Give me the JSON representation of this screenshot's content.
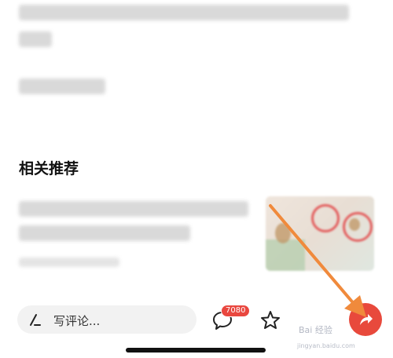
{
  "section": {
    "title": "相关推荐"
  },
  "bottom_bar": {
    "comment_placeholder": "写评论...",
    "comment_count": "7080"
  },
  "watermark": {
    "text": "Bai 经验",
    "sub": "jingyan.baidu.com"
  },
  "colors": {
    "accent": "#e8493c",
    "arrow": "#f08a3c",
    "badge": "#e9473f"
  },
  "icons": [
    "pen-icon",
    "comment-bubble-icon",
    "star-icon",
    "share-icon"
  ]
}
